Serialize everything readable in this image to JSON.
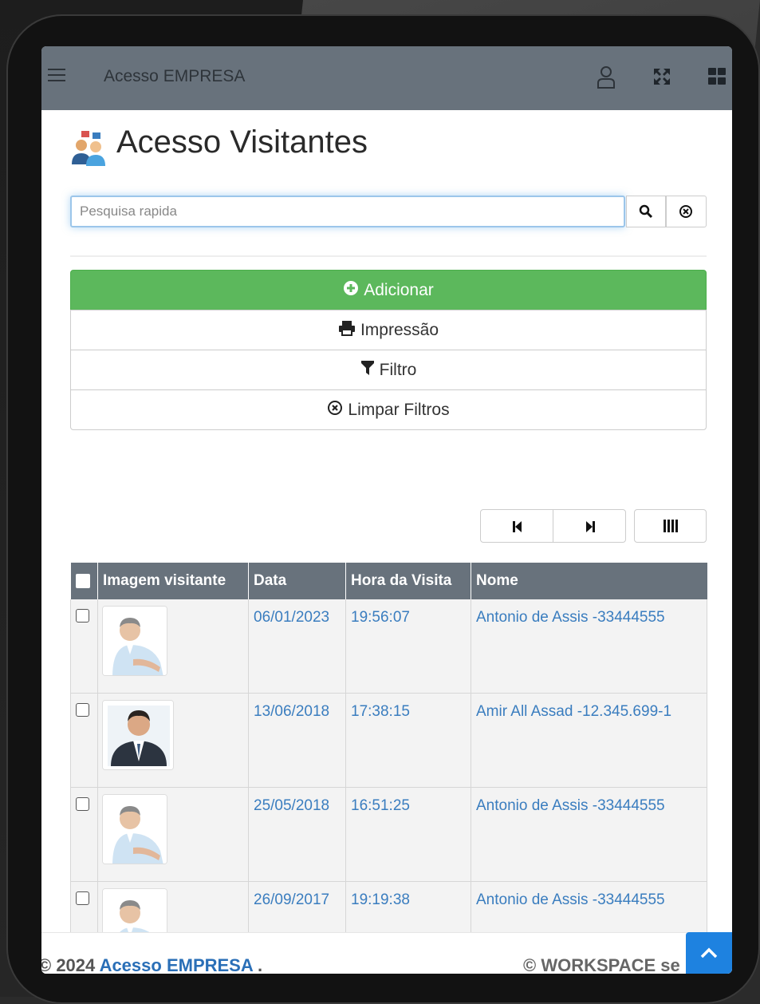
{
  "topbar": {
    "app_title": "Acesso EMPRESA",
    "icons": [
      "menu-icon",
      "user-icon",
      "expand-icon",
      "grid-icon"
    ],
    "background_color": "#68727c"
  },
  "page": {
    "title": "Acesso Visitantes",
    "title_icon": "visitors-icon"
  },
  "search": {
    "placeholder": "Pesquisa rapida",
    "value": ""
  },
  "actions": {
    "add_label": "Adicionar",
    "print_label": "Impressão",
    "filter_label": "Filtro",
    "clear_filters_label": "Limpar Filtros",
    "add_color": "#5cb85c"
  },
  "table": {
    "columns": [
      "",
      "Imagem visitante",
      "Data",
      "Hora da Visita",
      "Nome"
    ],
    "rows": [
      {
        "data": "06/01/2023",
        "hora": "19:56:07",
        "nome": "Antonio de Assis -33444555",
        "photo": "older-man-photo"
      },
      {
        "data": "13/06/2018",
        "hora": "17:38:15",
        "nome": "Amir All Assad -12.345.699-1",
        "photo": "young-man-suit-photo"
      },
      {
        "data": "25/05/2018",
        "hora": "16:51:25",
        "nome": "Antonio de Assis -33444555",
        "photo": "older-man-photo"
      },
      {
        "data": "26/09/2017",
        "hora": "19:19:38",
        "nome": "Antonio de Assis -33444555",
        "photo": "older-man-photo"
      }
    ]
  },
  "footer": {
    "copyright_prefix": "© 2024 ",
    "brand_link": "Acesso EMPRESA",
    "suffix": " .",
    "right_text": "© WORKSPACE se"
  }
}
